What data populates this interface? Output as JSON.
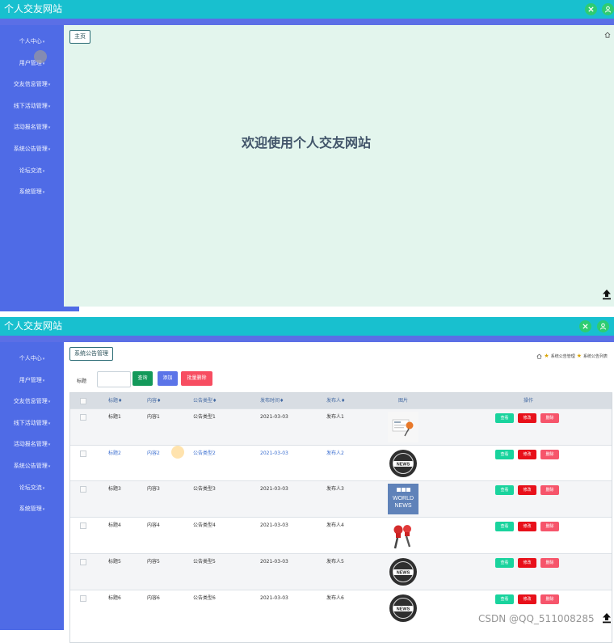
{
  "app": {
    "title": "个人交友网站"
  },
  "sidebar": {
    "items": [
      {
        "label": "个人中心"
      },
      {
        "label": "用户管理"
      },
      {
        "label": "交友信息管理"
      },
      {
        "label": "线下活动管理"
      },
      {
        "label": "活动报名管理"
      },
      {
        "label": "系统公告管理"
      },
      {
        "label": "论坛交流"
      },
      {
        "label": "系统管理"
      }
    ]
  },
  "screenA": {
    "tab": "主页",
    "welcome": "欢迎使用个人交友网站"
  },
  "screenB": {
    "tab": "系统公告管理",
    "breadcrumb": [
      "系统公告管理",
      "系统公告列表"
    ],
    "search": {
      "label": "标题",
      "value": ""
    },
    "buttons": {
      "query": "查询",
      "add": "添加",
      "batch_delete": "批量删除"
    },
    "table": {
      "headers": {
        "title": "标题♦",
        "content": "内容♦",
        "type": "公告类型♦",
        "date": "发布时间♦",
        "publisher": "发布人♦",
        "image": "图片",
        "actions": "操作"
      },
      "actions": {
        "view": "查看",
        "edit": "修改",
        "delete": "删除"
      },
      "rows": [
        {
          "title": "标题1",
          "content": "内容1",
          "type": "公告类型1",
          "date": "2021-03-03",
          "publisher": "发布人1",
          "image": "news-collage"
        },
        {
          "title": "标题2",
          "content": "内容2",
          "type": "公告类型2",
          "date": "2021-03-03",
          "publisher": "发布人2",
          "image": "news-badge"
        },
        {
          "title": "标题3",
          "content": "内容3",
          "type": "公告类型3",
          "date": "2021-03-03",
          "publisher": "发布人3",
          "image": "bbc-world-news"
        },
        {
          "title": "标题4",
          "content": "内容4",
          "type": "公告类型4",
          "date": "2021-03-03",
          "publisher": "发布人4",
          "image": "news-microphones"
        },
        {
          "title": "标题5",
          "content": "内容5",
          "type": "公告类型5",
          "date": "2021-03-03",
          "publisher": "发布人5",
          "image": "news-badge"
        },
        {
          "title": "标题6",
          "content": "内容6",
          "type": "公告类型6",
          "date": "2021-03-03",
          "publisher": "发布人6",
          "image": "news-badge"
        }
      ],
      "bbc_text": [
        "BBC",
        "WORLD",
        "NEWS"
      ],
      "badge_text": "NEWS"
    }
  },
  "colors": {
    "topbar": "#18c0cf",
    "sidebar": "#4f6be6",
    "welcome_bg": "#e3f5ed",
    "view": "#19d39d",
    "edit": "#e8101a",
    "delete": "#f6556b"
  },
  "watermark": "CSDN @QQ_511008285"
}
